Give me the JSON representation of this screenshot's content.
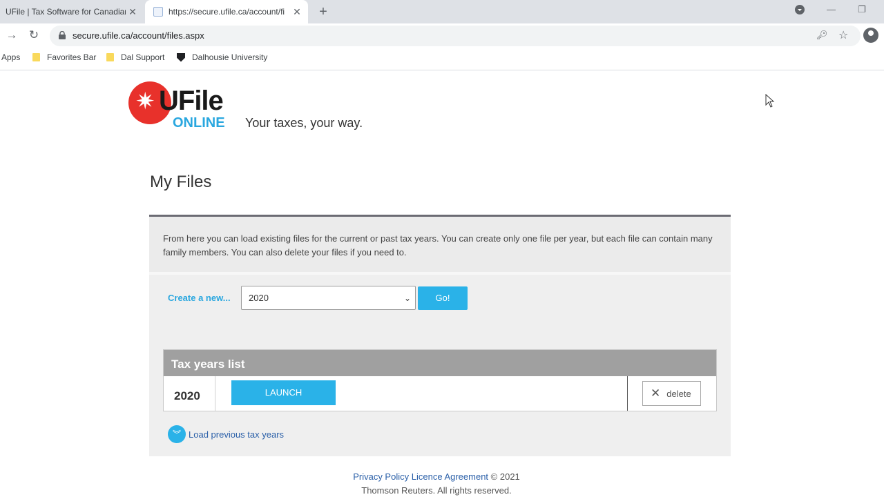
{
  "browser": {
    "tabs": [
      {
        "title": "UFile | Tax Software for Canadian",
        "active": false
      },
      {
        "title": "https://secure.ufile.ca/account/fi",
        "active": true
      }
    ],
    "url": "secure.ufile.ca/account/files.aspx",
    "bookmarks": [
      {
        "label": "Apps",
        "icon": "apps-icon"
      },
      {
        "label": "Favorites Bar",
        "icon": "folder-icon"
      },
      {
        "label": "Dal Support",
        "icon": "folder-icon"
      },
      {
        "label": "Dalhousie University",
        "icon": "shield-icon"
      }
    ]
  },
  "brand": {
    "logo_main": "UFile",
    "logo_sub": "ONLINE",
    "tagline": "Your taxes, your way.",
    "colors": {
      "red": "#e8312b",
      "blue": "#2aa7df"
    }
  },
  "page": {
    "title": "My Files",
    "intro": "From here you can load existing files for the current or past tax years. You can create only one file per year, but each file can contain many family members. You can also delete your files if you need to.",
    "create": {
      "label": "Create a new...",
      "selected_year": "2020",
      "go_label": "Go!"
    },
    "tax_years": {
      "heading": "Tax years list",
      "rows": [
        {
          "year": "2020",
          "launch_label": "LAUNCH",
          "delete_label": "delete"
        }
      ]
    },
    "load_previous": "Load previous tax years"
  },
  "footer": {
    "privacy": "Privacy Policy",
    "licence": "Licence Agreement",
    "copyright": "© 2021",
    "rights": "Thomson Reuters. All rights reserved."
  }
}
